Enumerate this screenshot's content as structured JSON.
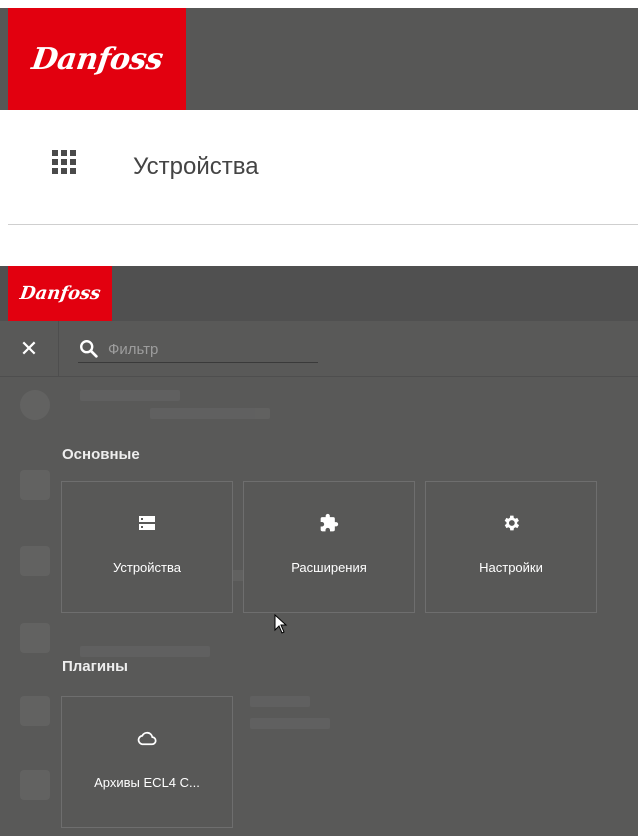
{
  "top": {
    "brand": "Danfoss",
    "nav_title": "Устройства"
  },
  "bottom": {
    "brand": "Danfoss",
    "search": {
      "placeholder": "Фильтр",
      "value": ""
    },
    "sections": {
      "main": {
        "title": "Основные",
        "tiles": [
          {
            "label": "Устройства",
            "icon": "devices-icon"
          },
          {
            "label": "Расширения",
            "icon": "puzzle-icon"
          },
          {
            "label": "Настройки",
            "icon": "gear-icon"
          }
        ]
      },
      "plugins": {
        "title": "Плагины",
        "tiles": [
          {
            "label": "Архивы ECL4 C...",
            "icon": "cloud-icon"
          }
        ]
      }
    }
  },
  "colors": {
    "brand_red": "#e2000f",
    "header_gray": "#575756",
    "overlay_gray": "#595958"
  }
}
